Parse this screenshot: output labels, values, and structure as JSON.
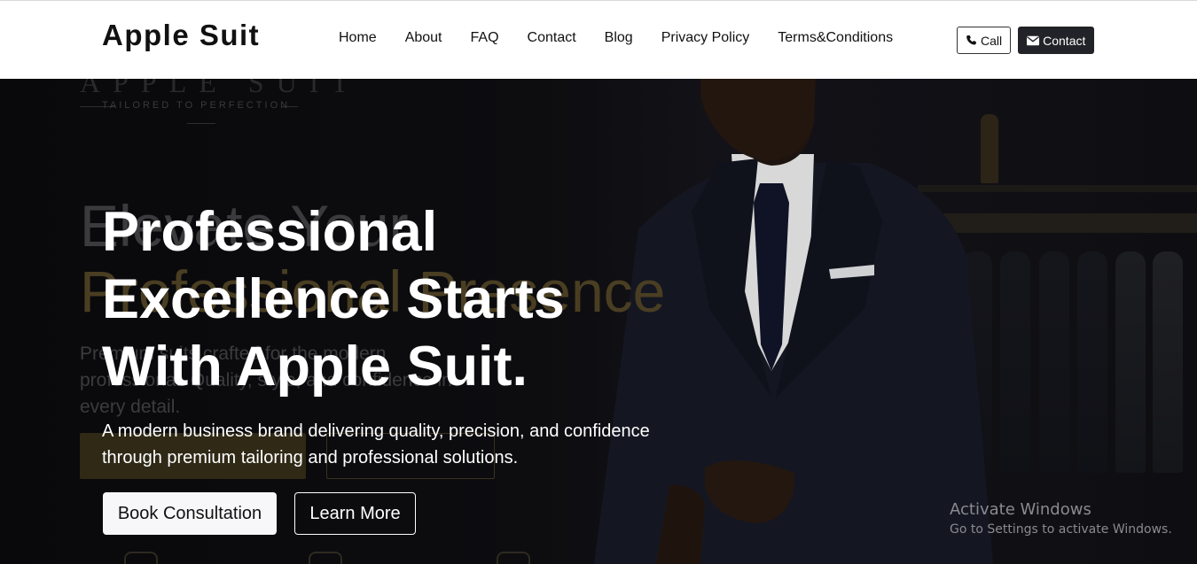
{
  "navbar": {
    "brand": "Apple Suit",
    "links": [
      "Home",
      "About",
      "FAQ",
      "Contact",
      "Blog",
      "Privacy Policy",
      "Terms&Conditions"
    ],
    "call_label": "Call",
    "contact_label": "Contact"
  },
  "hero": {
    "title": "Professional Excellence Starts With Apple Suit.",
    "subtitle": "A modern business brand delivering quality, precision, and confidence through premium tailoring and professional solutions.",
    "primary_button": "Book Consultation",
    "secondary_button": "Learn More",
    "background_image": {
      "logo_text": "APPLE SUIT",
      "tagline": "TAILORED TO PERFECTION",
      "heading_line1": "Elevate Your",
      "heading_line2": "Professional Presence",
      "paragraph": "Premium suits crafted for the modern professional. Quality, style, and confidence in every detail."
    }
  },
  "watermark": {
    "title": "Activate Windows",
    "subtitle": "Go to Settings to activate Windows."
  },
  "colors": {
    "navbar_bg": "#ffffff",
    "hero_bg": "#0b0b0d",
    "contact_button_bg": "#222328",
    "gold_accent": "#4a3e22"
  },
  "icons": {
    "call": "phone-icon",
    "contact": "envelope-icon"
  }
}
